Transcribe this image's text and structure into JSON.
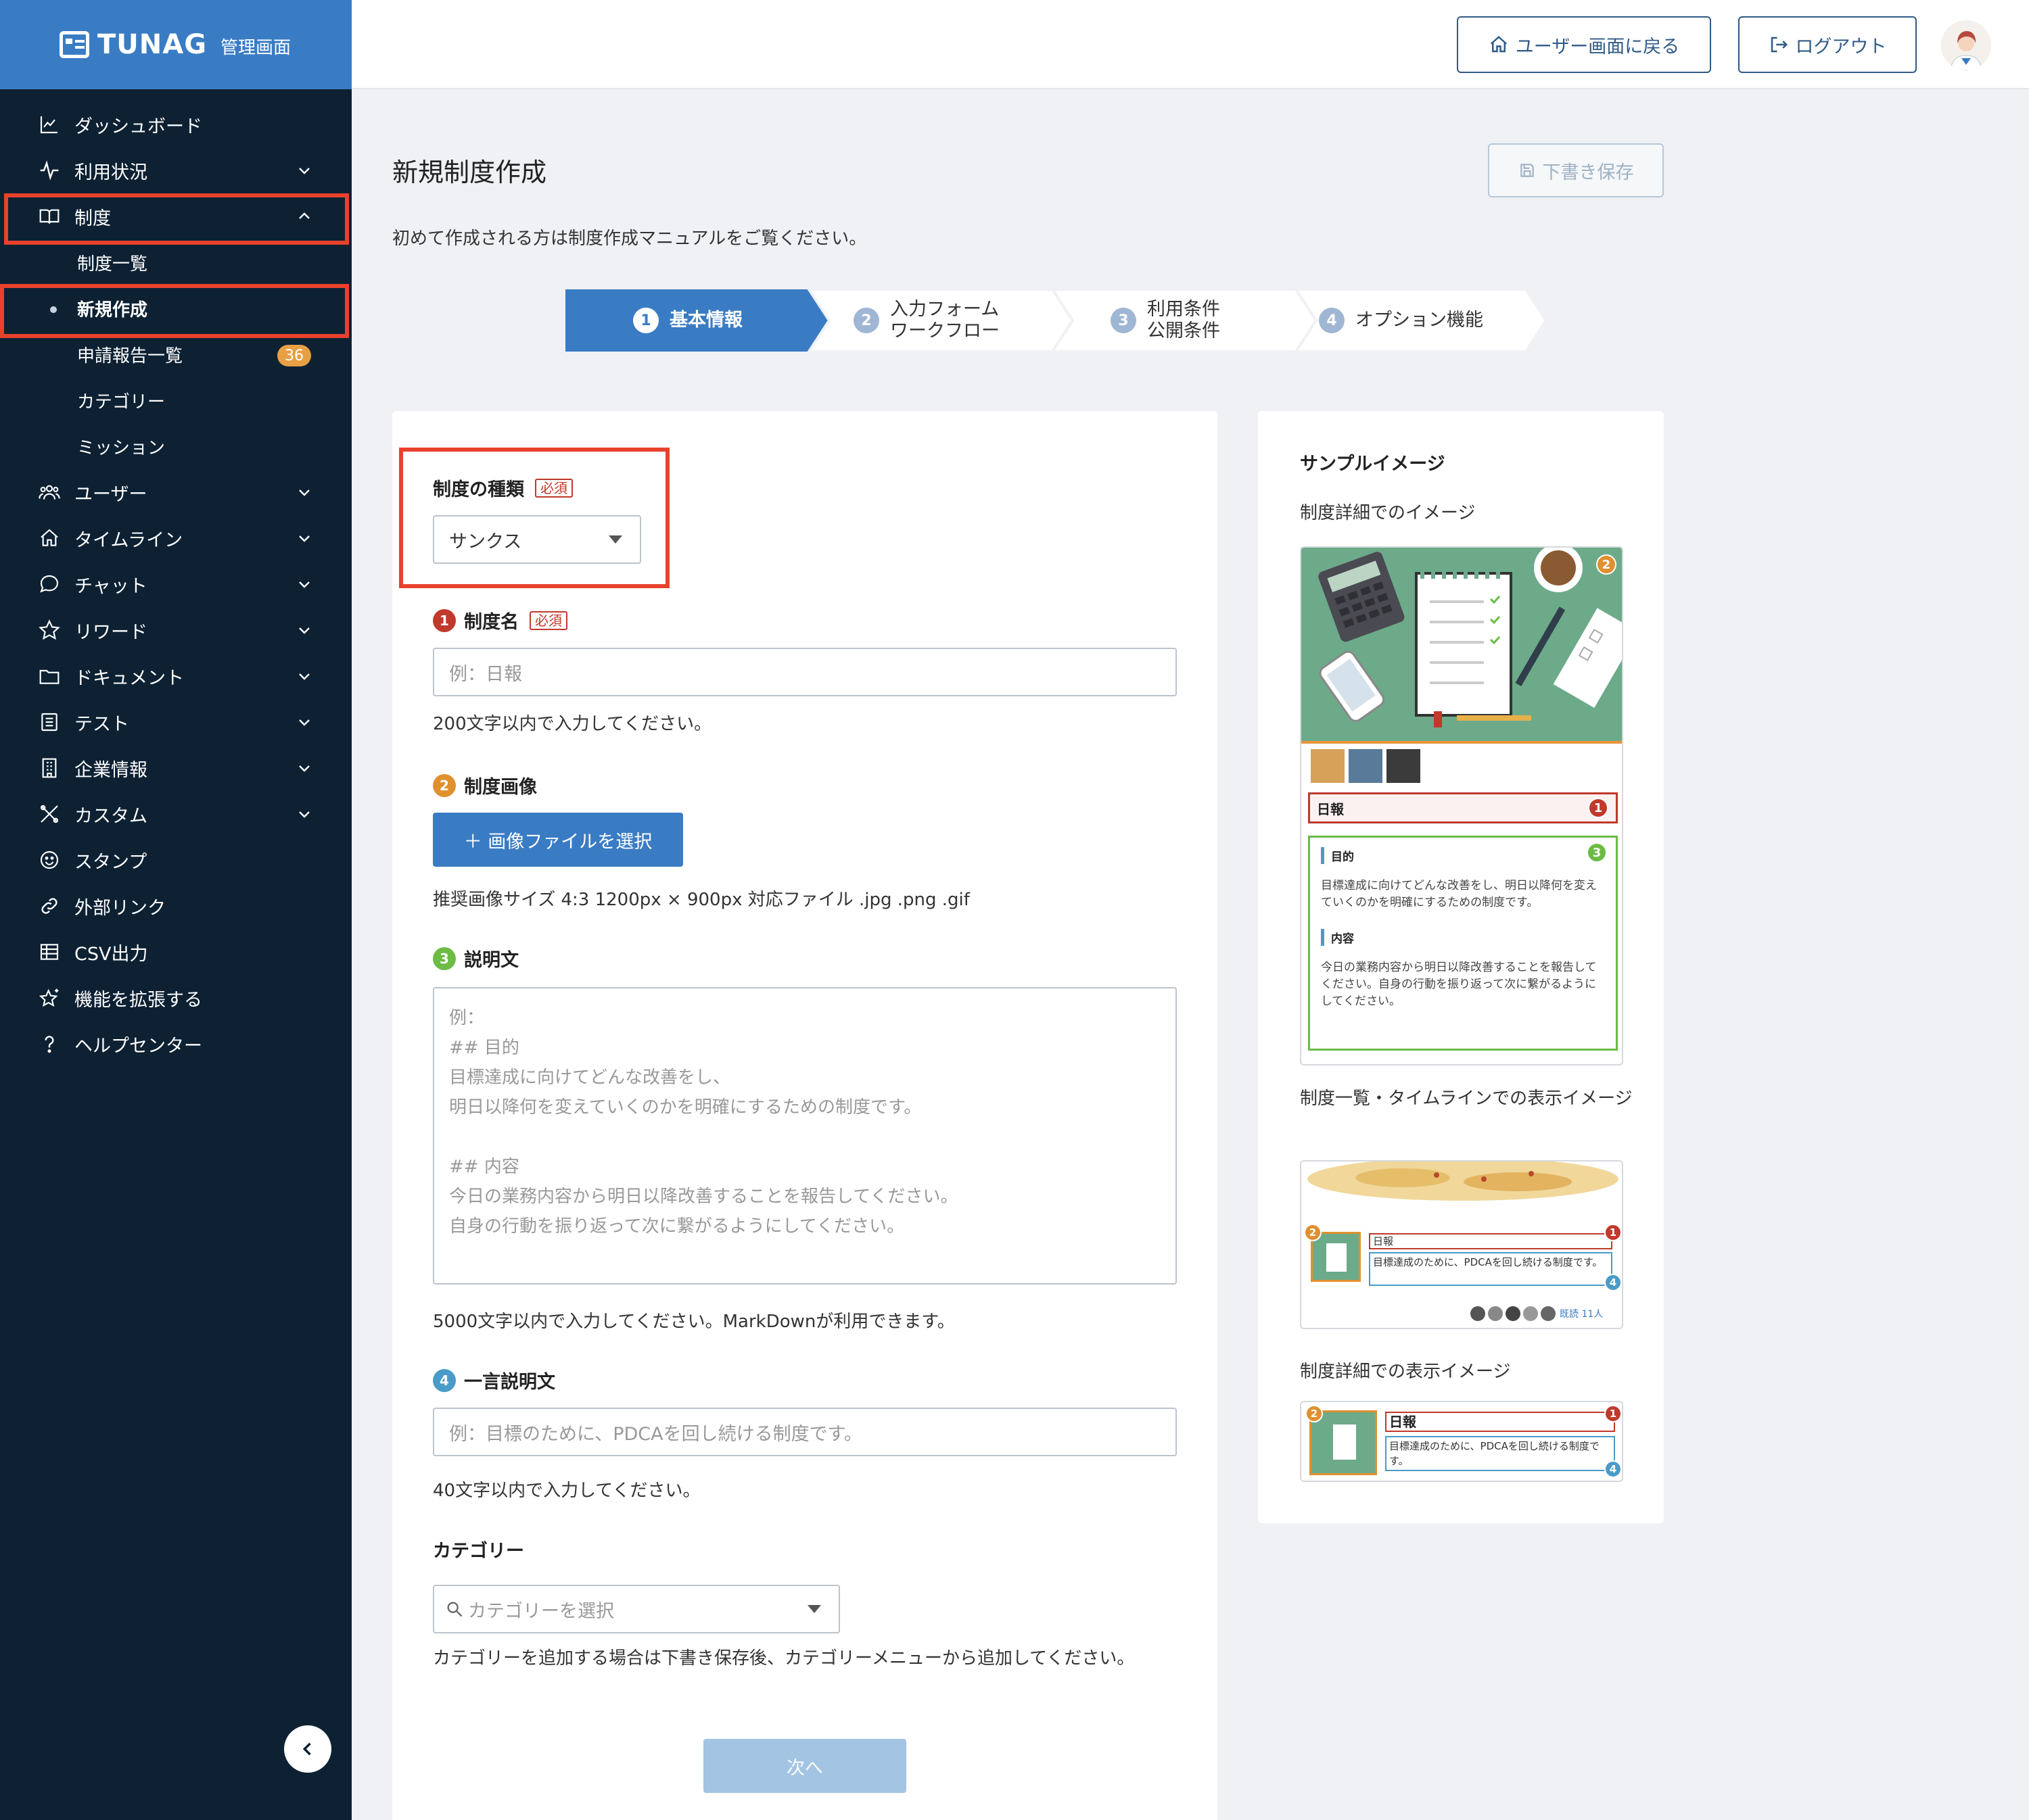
{
  "brand": {
    "name": "TUNAG",
    "sub": "管理画面"
  },
  "sidebar": {
    "items": [
      {
        "label": "ダッシュボード",
        "icon": "chart-line-icon"
      },
      {
        "label": "利用状況",
        "icon": "activity-icon"
      },
      {
        "label": "制度",
        "icon": "book-open-icon"
      },
      {
        "label": "ユーザー",
        "icon": "users-icon"
      },
      {
        "label": "タイムライン",
        "icon": "home-icon"
      },
      {
        "label": "チャット",
        "icon": "chat-bubble-icon"
      },
      {
        "label": "リワード",
        "icon": "star-icon"
      },
      {
        "label": "ドキュメント",
        "icon": "folder-icon"
      },
      {
        "label": "テスト",
        "icon": "checklist-icon"
      },
      {
        "label": "企業情報",
        "icon": "building-icon"
      },
      {
        "label": "カスタム",
        "icon": "tools-icon"
      },
      {
        "label": "スタンプ",
        "icon": "smile-icon"
      },
      {
        "label": "外部リンク",
        "icon": "link-icon"
      },
      {
        "label": "CSV出力",
        "icon": "table-icon"
      },
      {
        "label": "機能を拡張する",
        "icon": "sparkle-star-icon"
      },
      {
        "label": "ヘルプセンター",
        "icon": "question-icon"
      }
    ],
    "sub_items": [
      {
        "label": "制度一覧"
      },
      {
        "label": "新規作成"
      },
      {
        "label": "申請報告一覧",
        "badge": "36"
      },
      {
        "label": "カテゴリー"
      },
      {
        "label": "ミッション"
      }
    ]
  },
  "header": {
    "back_button": "ユーザー画面に戻る",
    "logout_button": "ログアウト"
  },
  "main": {
    "title": "新規制度作成",
    "draft_button": "下書き保存",
    "intro": "初めて作成される方は制度作成マニュアルをご覧ください。",
    "steps": [
      {
        "num": "1",
        "line1": "基本情報",
        "line2": ""
      },
      {
        "num": "2",
        "line1": "入力フォーム",
        "line2": "ワークフロー"
      },
      {
        "num": "3",
        "line1": "利用条件",
        "line2": "公開条件"
      },
      {
        "num": "4",
        "line1": "オプション機能",
        "line2": ""
      }
    ]
  },
  "form": {
    "required": "必須",
    "type": {
      "label": "制度の種類",
      "value": "サンクス"
    },
    "name": {
      "num": "1",
      "label": "制度名",
      "placeholder": "例：日報",
      "help": "200文字以内で入力してください。"
    },
    "image": {
      "num": "2",
      "label": "制度画像",
      "button": "＋ 画像ファイルを選択",
      "help": "推奨画像サイズ 4:3 1200px × 900px 対応ファイル .jpg .png .gif"
    },
    "description": {
      "num": "3",
      "label": "説明文",
      "placeholder": "例：\n## 目的\n目標達成に向けてどんな改善をし、\n明日以降何を変えていくのかを明確にするための制度です。\n\n## 内容\n今日の業務内容から明日以降改善することを報告してください。\n自身の行動を振り返って次に繋がるようにしてください。",
      "help": "5000文字以内で入力してください。MarkDownが利用できます。"
    },
    "short_description": {
      "num": "4",
      "label": "一言説明文",
      "placeholder": "例：目標のために、PDCAを回し続ける制度です。",
      "help": "40文字以内で入力してください。"
    },
    "category": {
      "label": "カテゴリー",
      "placeholder": "カテゴリーを選択",
      "help": "カテゴリーを追加する場合は下書き保存後、カテゴリーメニューから追加してください。"
    },
    "next_button": "次へ"
  },
  "sample": {
    "title": "サンプルイメージ",
    "detail_label": "制度詳細でのイメージ",
    "list_label": "制度一覧・タイムラインでの表示イメージ",
    "detail_display_label": "制度詳細での表示イメージ",
    "mock": {
      "name": "日報",
      "purpose_h": "目的",
      "purpose_t": "目標達成に向けてどんな改善をし、明日以降何を変えていくのかを明確にするための制度です。",
      "content_h": "内容",
      "content_t": "今日の業務内容から明日以降改善することを報告してください。自身の行動を振り返って次に繋がるようにしてください。",
      "short": "目標達成のために、PDCAを回し続ける制度です。",
      "read": "既読 11人"
    }
  },
  "colors": {
    "primary": "#3a7cc4",
    "sidebar_bg": "#0d2133",
    "highlight": "#e8412c",
    "num1": "#c0392b",
    "num2": "#e0902f",
    "num3": "#6cbb45",
    "num4": "#4a9bc7"
  }
}
